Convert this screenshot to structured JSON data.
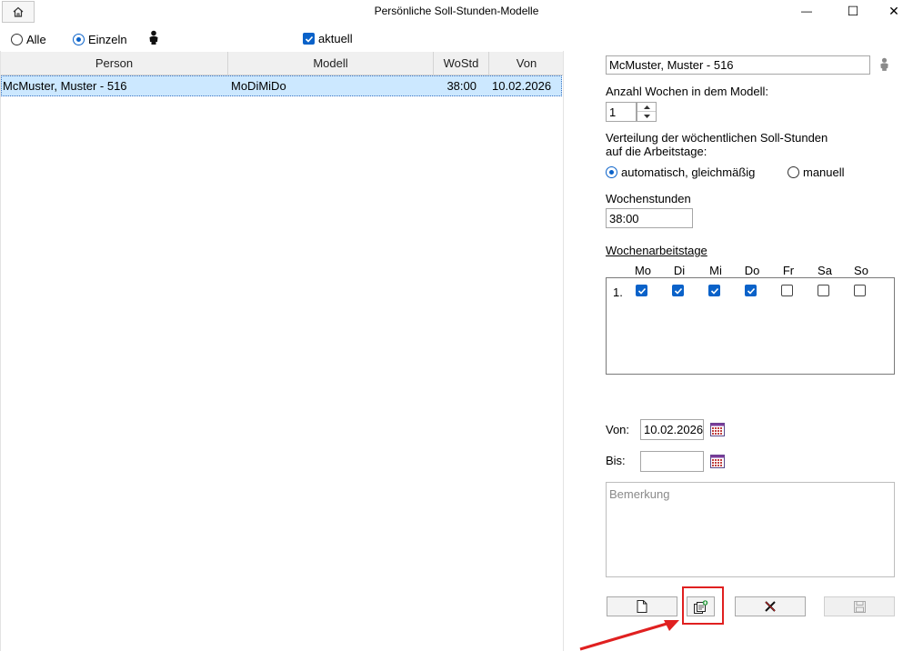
{
  "window": {
    "title": "Persönliche Soll-Stunden-Modelle",
    "minimize_glyph": "—",
    "maximize_glyph": "☐",
    "close_glyph": "✕"
  },
  "filter": {
    "all_label": "Alle",
    "single_label": "Einzeln",
    "current_label": "aktuell",
    "selected_mode": "Einzeln",
    "current_checked": true
  },
  "grid": {
    "columns": [
      {
        "label": "Person"
      },
      {
        "label": "Modell"
      },
      {
        "label": "WoStd"
      },
      {
        "label": "Von"
      }
    ],
    "rows": [
      {
        "person": "McMuster, Muster - 516",
        "model": "MoDiMiDo",
        "hours": "38:00",
        "from": "10.02.2026"
      }
    ]
  },
  "details": {
    "person_value": "McMuster, Muster - 516",
    "weeks_label": "Anzahl Wochen in dem Modell:",
    "weeks_value": "1",
    "distribution_label_line1": "Verteilung der wöchentlichen Soll-Stunden",
    "distribution_label_line2": "auf die Arbeitstage:",
    "auto_label": "automatisch, gleichmäßig",
    "manual_label": "manuell",
    "selected_distribution": "automatisch",
    "weekly_hours_label": "Wochenstunden",
    "weekly_hours_value": "38:00",
    "workdays_label": "Wochenarbeitstage",
    "days": [
      {
        "label": "Mo",
        "checked": true
      },
      {
        "label": "Di",
        "checked": true
      },
      {
        "label": "Mi",
        "checked": true
      },
      {
        "label": "Do",
        "checked": true
      },
      {
        "label": "Fr",
        "checked": false
      },
      {
        "label": "Sa",
        "checked": false
      },
      {
        "label": "So",
        "checked": false
      }
    ],
    "week_row_label": "1.",
    "from_label": "Von:",
    "from_value": "10.02.2026",
    "to_label": "Bis:",
    "to_value": "",
    "remark_placeholder": "Bemerkung"
  },
  "colors": {
    "accent": "#0a62c9",
    "selected_row": "#cce8ff",
    "highlight": "#e02020"
  }
}
